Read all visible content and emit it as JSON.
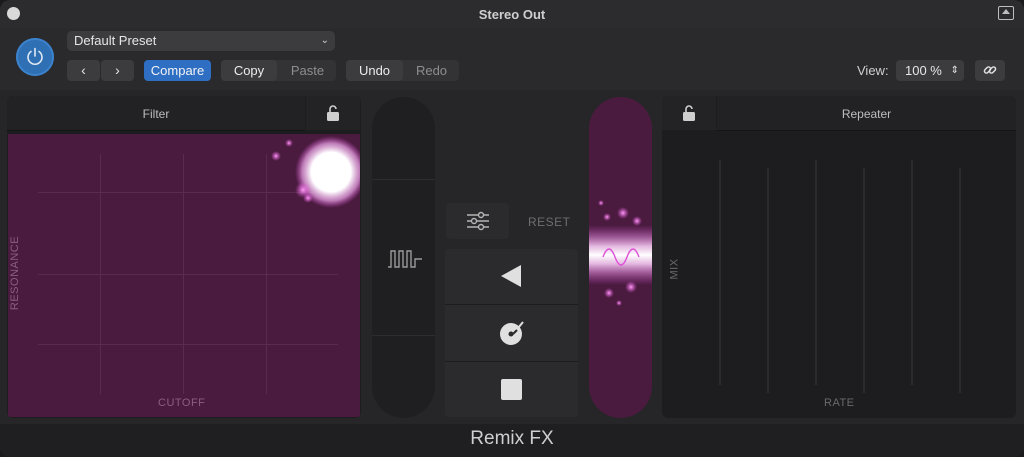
{
  "window": {
    "title": "Stereo Out",
    "footer_title": "Remix FX"
  },
  "header": {
    "preset": "Default Preset",
    "back_label": "‹",
    "forward_label": "›",
    "compare_label": "Compare",
    "copy_label": "Copy",
    "paste_label": "Paste",
    "undo_label": "Undo",
    "redo_label": "Redo",
    "view_label": "View:",
    "zoom_value": "100 %"
  },
  "filter": {
    "title": "Filter",
    "x_label": "CUTOFF",
    "y_label": "RESONANCE"
  },
  "center": {
    "reset_label": "RESET"
  },
  "repeater": {
    "title": "Repeater",
    "x_label": "RATE",
    "y_label": "MIX"
  },
  "colors": {
    "accent_blue": "#2e6fc4",
    "pad_purple": "#4a1b3f",
    "glow_pink": "#e04fd8"
  }
}
